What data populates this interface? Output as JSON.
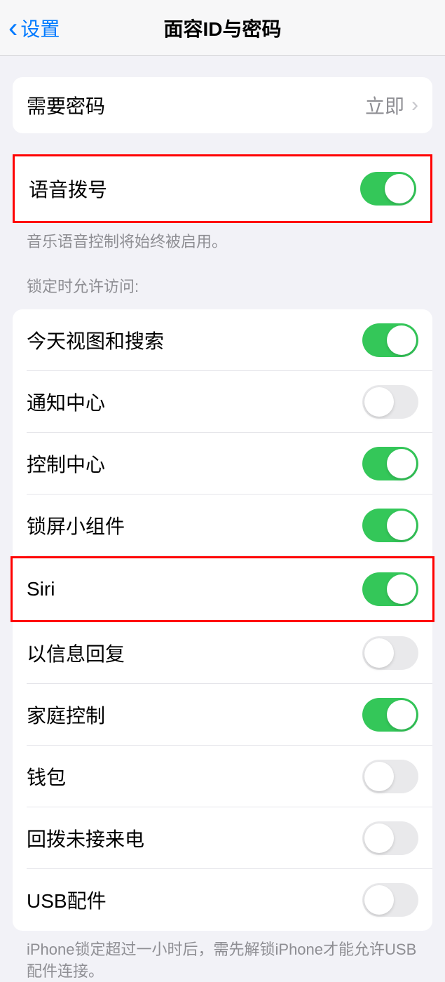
{
  "header": {
    "back_label": "设置",
    "title": "面容ID与密码"
  },
  "section1": {
    "require_passcode": {
      "label": "需要密码",
      "value": "立即"
    }
  },
  "voice_dial": {
    "label": "语音拨号",
    "enabled": true,
    "footer": "音乐语音控制将始终被启用。"
  },
  "lock_access": {
    "header": "锁定时允许访问:",
    "items": [
      {
        "label": "今天视图和搜索",
        "enabled": true
      },
      {
        "label": "通知中心",
        "enabled": false
      },
      {
        "label": "控制中心",
        "enabled": true
      },
      {
        "label": "锁屏小组件",
        "enabled": true
      },
      {
        "label": "Siri",
        "enabled": true
      },
      {
        "label": "以信息回复",
        "enabled": false
      },
      {
        "label": "家庭控制",
        "enabled": true
      },
      {
        "label": "钱包",
        "enabled": false
      },
      {
        "label": "回拨未接来电",
        "enabled": false
      },
      {
        "label": "USB配件",
        "enabled": false
      }
    ],
    "footer": "iPhone锁定超过一小时后，需先解锁iPhone才能允许USB配件连接。"
  },
  "highlights": {
    "voice_dial": true,
    "siri_index": 4
  }
}
